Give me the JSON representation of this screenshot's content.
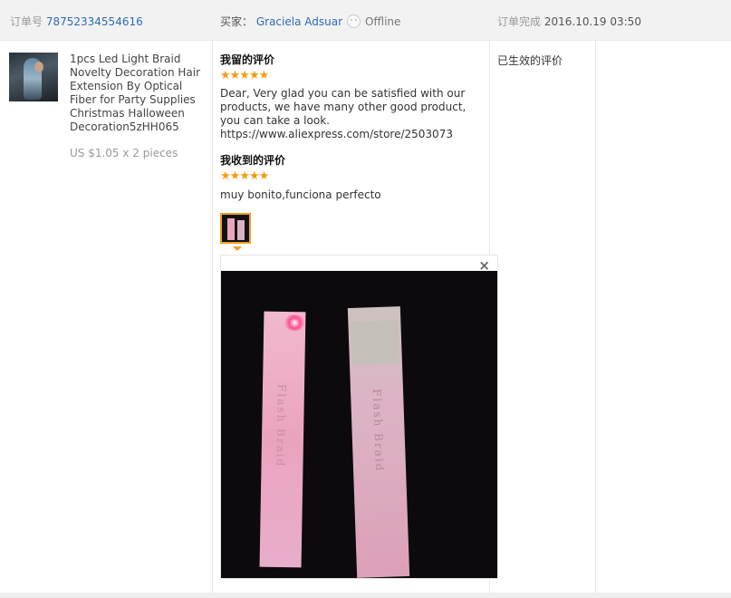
{
  "header": {
    "order_label": "订单号",
    "order_number": "78752334554616",
    "buyer_label": "买家：",
    "buyer_name": "Graciela Adsuar",
    "buyer_status": "Offline",
    "complete_label": "订单完成",
    "complete_time": "2016.10.19 03:50"
  },
  "product": {
    "title": "1pcs Led Light Braid Novelty Decoration Hair Extension By Optical Fiber for Party Supplies Christmas Halloween Decoration5zHH065",
    "price": "US $1.05 x 2 pieces"
  },
  "review": {
    "my_review_title": "我留的评价",
    "my_stars": "★★★★★",
    "my_rating": 5,
    "my_text": "Dear, Very glad you can be satisfied with our products, we have many other good product, you can take a look. https://www.aliexpress.com/store/2503073",
    "received_title": "我收到的评价",
    "received_stars": "★★★★★",
    "received_rating": 5,
    "received_text": "muy bonito,funciona perfecto",
    "close_symbol": "×"
  },
  "status": {
    "text": "已生效的评价"
  },
  "colors": {
    "link": "#2d6bb5",
    "star": "#f39c12",
    "highlight_border": "#f0a020",
    "header_bg": "#f2f2f2"
  }
}
